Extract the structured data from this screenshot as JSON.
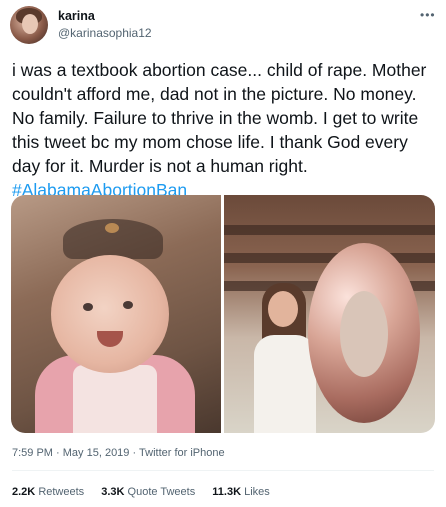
{
  "user": {
    "name": "karina",
    "handle": "@karinasophia12"
  },
  "tweet": {
    "text": "i was a textbook abortion case... child of rape. Mother couldn't afford me, dad not in the picture. No money. No family. Failure to thrive in the womb. I get to write this tweet bc my mom chose life. I thank God every day for it. Murder is not a human right.",
    "hashtag": "#AlabamaAbortionBan"
  },
  "meta": {
    "time": "7:59 PM",
    "date": "May 15, 2019",
    "source": "Twitter for iPhone",
    "separator": "·"
  },
  "stats": {
    "retweets": {
      "count": "2.2K",
      "label": "Retweets"
    },
    "quotes": {
      "count": "3.3K",
      "label": "Quote Tweets"
    },
    "likes": {
      "count": "11.3K",
      "label": "Likes"
    }
  },
  "icons": {
    "more": "more-options-icon"
  },
  "colors": {
    "link": "#1d9bf0",
    "text": "#0f1419",
    "secondary": "#536471"
  }
}
